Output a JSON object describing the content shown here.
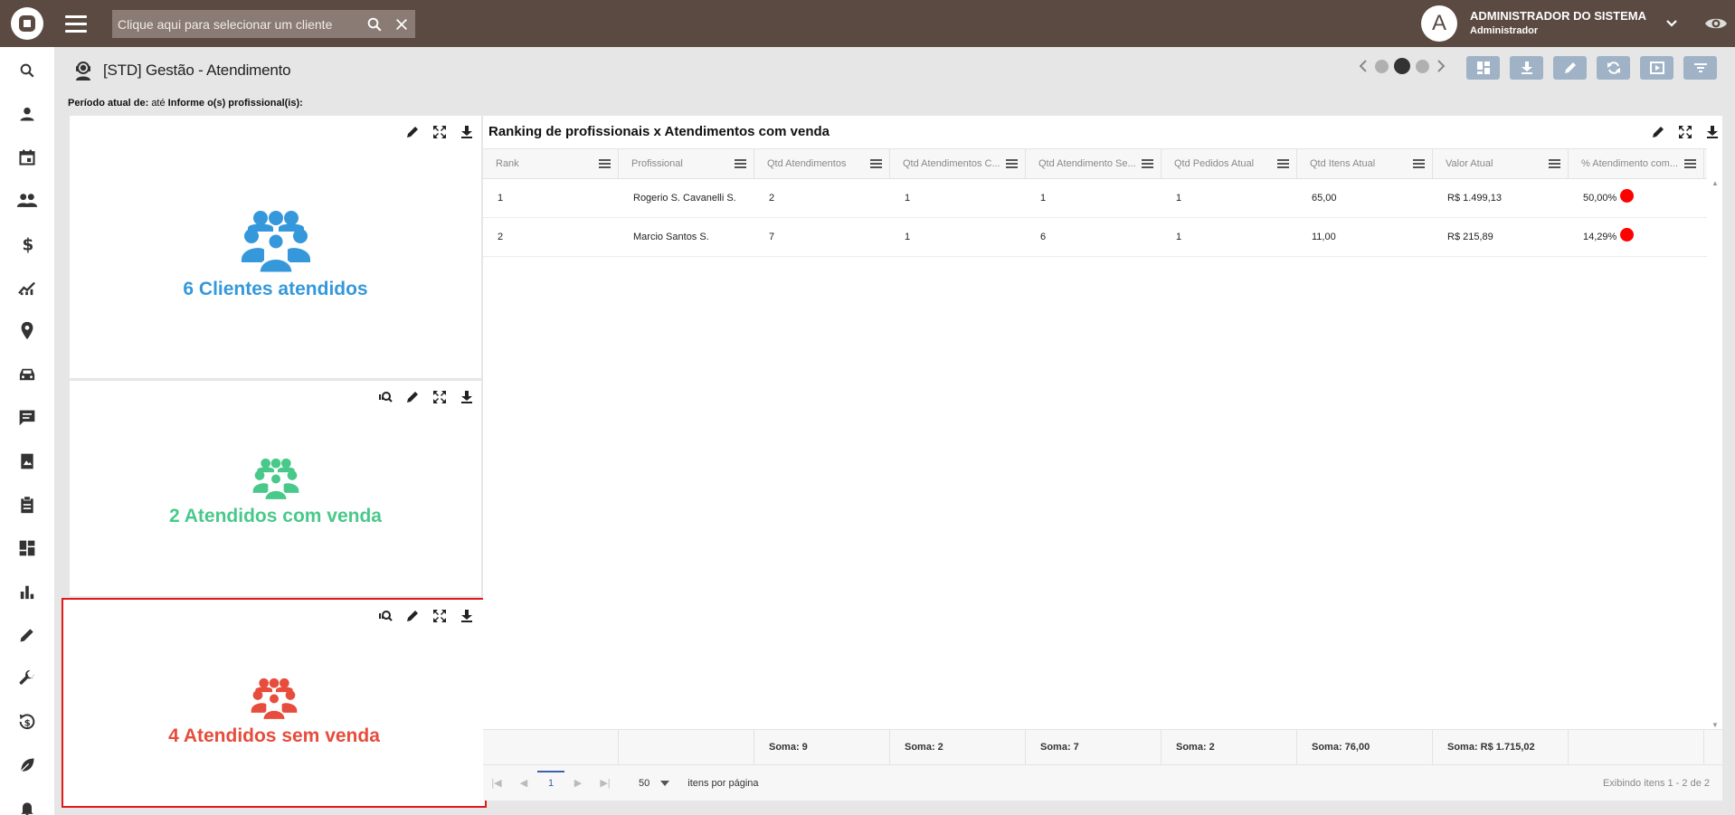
{
  "header": {
    "search_placeholder": "Clique aqui para selecionar um cliente",
    "user_initial": "A",
    "user_name": "ADMINISTRADOR DO SISTEMA",
    "user_role": "Administrador"
  },
  "sidebar": {
    "icons": [
      "search-icon",
      "person-icon",
      "calendar-icon",
      "group-icon",
      "dollar-icon",
      "trending-up-icon",
      "location-pin-icon",
      "car-icon",
      "chat-icon",
      "photo-album-icon",
      "clipboard-icon",
      "dashboard-icon",
      "bar-chart-icon",
      "pencil-icon",
      "wrench-icon",
      "history-dollar-icon",
      "leaf-icon",
      "bell-icon"
    ]
  },
  "page": {
    "title": "[STD] Gestão - Atendimento",
    "periodo_label": "Período atual de:",
    "periodo_value": "até",
    "profissional_label": "Informe o(s) profissional(is):"
  },
  "kpis": [
    {
      "text": "6 Clientes atendidos",
      "color": "#3498db"
    },
    {
      "text": "2 Atendidos com venda",
      "color": "#48c98a"
    },
    {
      "text": "4 Atendidos sem venda",
      "color": "#e74c3c"
    }
  ],
  "table": {
    "title": "Ranking de profissionais x Atendimentos com venda",
    "columns": [
      "Rank",
      "Profissional",
      "Qtd Atendimentos",
      "Qtd Atendimentos C...",
      "Qtd Atendimento Se...",
      "Qtd Pedidos Atual",
      "Qtd Itens Atual",
      "Valor Atual",
      "% Atendimento com..."
    ],
    "rows": [
      [
        "1",
        "Rogerio S. Cavanelli S.",
        "2",
        "1",
        "1",
        "1",
        "65,00",
        "R$ 1.499,13",
        "50,00%"
      ],
      [
        "2",
        "Marcio Santos S.",
        "7",
        "1",
        "6",
        "1",
        "11,00",
        "R$ 215,89",
        "14,29%"
      ]
    ],
    "footer": [
      "",
      "",
      "Soma: 9",
      "Soma: 2",
      "Soma: 7",
      "Soma: 2",
      "Soma: 76,00",
      "Soma: R$ 1.715,02",
      ""
    ],
    "pager": {
      "page": "1",
      "page_size": "50",
      "per_page_label": "itens por página",
      "info": "Exibindo itens 1 - 2 de 2"
    }
  },
  "colors": {
    "topbar": "#5a4a42",
    "toolbar_button": "#9fb2c6",
    "highlight": "#e0191c"
  }
}
